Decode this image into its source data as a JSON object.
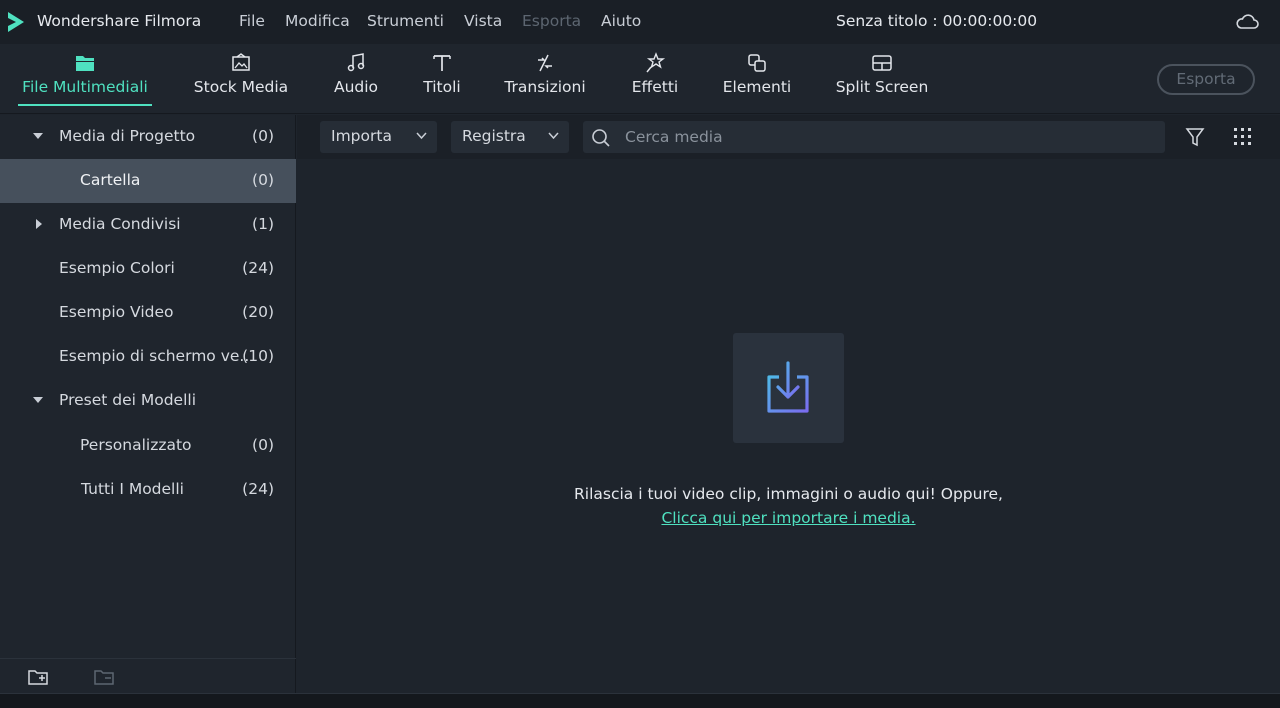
{
  "app": {
    "name": "Wondershare Filmora",
    "logo_icon": "filmora-logo-icon",
    "accent": "#4fe1c0"
  },
  "menu": [
    {
      "label": "File",
      "enabled": true
    },
    {
      "label": "Modifica",
      "enabled": true
    },
    {
      "label": "Strumenti",
      "enabled": true
    },
    {
      "label": "Vista",
      "enabled": true
    },
    {
      "label": "Esporta",
      "enabled": false
    },
    {
      "label": "Aiuto",
      "enabled": true
    }
  ],
  "project_title": "Senza titolo : 00:00:00:00",
  "toolbar": {
    "tabs": [
      {
        "label": "File Multimediali",
        "icon": "folder-icon",
        "active": true
      },
      {
        "label": "Stock Media",
        "icon": "stock-media-icon",
        "active": false
      },
      {
        "label": "Audio",
        "icon": "music-note-icon",
        "active": false
      },
      {
        "label": "Titoli",
        "icon": "text-icon",
        "active": false
      },
      {
        "label": "Transizioni",
        "icon": "transition-icon",
        "active": false
      },
      {
        "label": "Effetti",
        "icon": "magic-wand-icon",
        "active": false
      },
      {
        "label": "Elementi",
        "icon": "elements-icon",
        "active": false
      },
      {
        "label": "Split Screen",
        "icon": "split-screen-icon",
        "active": false
      }
    ],
    "export_label": "Esporta"
  },
  "sidebar": {
    "items": [
      {
        "label": "Media di Progetto",
        "count": "(0)",
        "expanded": true
      },
      {
        "label": "Cartella",
        "count": "(0)",
        "selected": true
      },
      {
        "label": "Media Condivisi",
        "count": "(1)",
        "expanded": false
      },
      {
        "label": "Esempio Colori",
        "count": "(24)"
      },
      {
        "label": "Esempio Video",
        "count": "(20)"
      },
      {
        "label": "Esempio di schermo ve..",
        "count": "(10)"
      },
      {
        "label": "Preset dei Modelli",
        "expanded": true
      },
      {
        "label": "Personalizzato",
        "count": "(0)"
      },
      {
        "label": "Tutti I Modelli",
        "count": "(24)"
      }
    ]
  },
  "media_toolbar": {
    "import_label": "Importa",
    "record_label": "Registra",
    "search_placeholder": "Cerca media"
  },
  "empty_state": {
    "icon": "import-icon",
    "message": "Rilascia i tuoi video clip, immagini o audio qui! Oppure,",
    "link": "Clicca qui per importare i media."
  }
}
